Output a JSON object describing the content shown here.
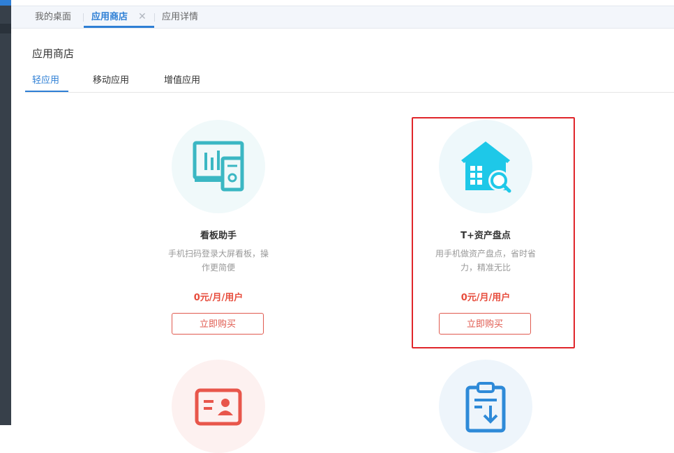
{
  "tabs": [
    {
      "label": "我的桌面",
      "active": false
    },
    {
      "label": "应用商店",
      "active": true,
      "closable": true
    },
    {
      "label": "应用详情",
      "active": false
    }
  ],
  "tab_close_glyph": "✕",
  "page_title": "应用商店",
  "subtabs": [
    {
      "label": "轻应用",
      "active": true
    },
    {
      "label": "移动应用",
      "active": false
    },
    {
      "label": "增值应用",
      "active": false
    }
  ],
  "apps": [
    {
      "name": "看板助手",
      "desc_line1": "手机扫码登录大屏看板，操",
      "desc_line2": "作更简便",
      "price": "0元/月/用户",
      "button": "立即购买",
      "icon": "dashboard-monitor-icon",
      "icon_color": "#3bb7c3",
      "circle_color": "#f0f9fa"
    },
    {
      "name": "T+资产盘点",
      "desc_line1": "用手机做资产盘点，省时省",
      "desc_line2": "力，精准无比",
      "price": "0元/月/用户",
      "button": "立即购买",
      "icon": "house-search-icon",
      "icon_color": "#1ec8e8",
      "circle_color": "#eef8fb",
      "highlighted": true
    },
    {
      "icon": "id-card-icon",
      "icon_color": "#e8564b",
      "circle_color": "#fdf1f0"
    },
    {
      "icon": "clipboard-download-icon",
      "icon_color": "#2e8ad8",
      "circle_color": "#eef5fb"
    }
  ],
  "colors": {
    "accent": "#2e7fd5",
    "price": "#e74c3c",
    "highlight": "#e0252a"
  }
}
